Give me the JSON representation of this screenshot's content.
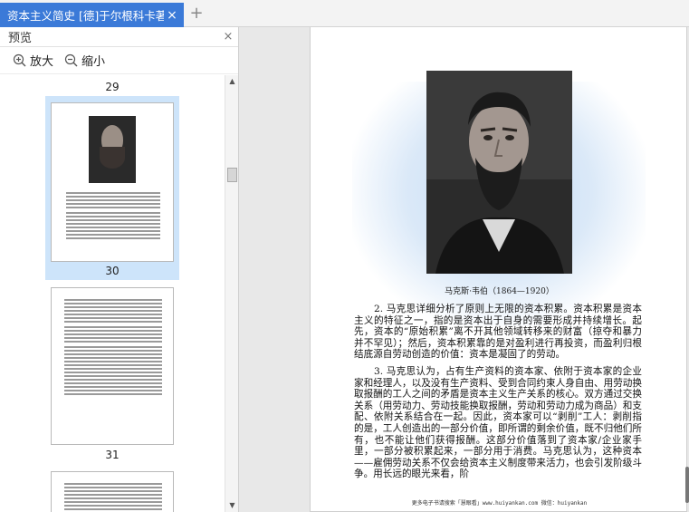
{
  "tab": {
    "title": "资本主义简史 [德]于尔根科卡著",
    "close": "×",
    "add": "+"
  },
  "preview": {
    "title": "预览",
    "close": "×",
    "zoom_in": "放大",
    "zoom_out": "缩小",
    "page_numbers": [
      "29",
      "30",
      "31"
    ]
  },
  "page": {
    "caption": "马克斯·韦伯（1864—1920）",
    "paragraph1": "2. 马克思详细分析了原则上无限的资本积累。资本积累是资本主义的特征之一，指的是资本出于自身的需要形成并持续增长。起先，资本的“原始积累”离不开其他领域转移来的财富（掠夺和暴力并不罕见）；然后，资本积累靠的是对盈利进行再投资，而盈利归根结底源自劳动创造的价值：资本是凝固了的劳动。",
    "paragraph2": "3. 马克思认为，占有生产资料的资本家、依附于资本家的企业家和经理人，以及没有生产资料、受到合同约束人身自由、用劳动换取报酬的工人之间的矛盾是资本主义生产关系的核心。双方通过交换关系（用劳动力、劳动技能换取报酬，劳动和劳动力成为商品）和支配、依附关系结合在一起。因此，资本家可以“剥削”工人：剥削指的是，工人创造出的一部分价值，即所谓的剩余价值，既不归他们所有，也不能让他们获得报酬。这部分价值落到了资本家/企业家手里，一部分被积累起来，一部分用于消费。马克思认为，这种资本——雇佣劳动关系不仅会给资本主义制度带来活力，也会引发阶级斗争。用长远的眼光来看，阶",
    "footer": "更多电子书请搜索「慧眼看」www.huiyankan.com  微信：huiyankan"
  },
  "colors": {
    "tab_active": "#3b7ad8",
    "selection": "#cde4fa",
    "glow": "#c4dcf5"
  },
  "icons": [
    "zoom-in-icon",
    "zoom-out-icon",
    "close-icon",
    "plus-icon",
    "scroll-up-icon",
    "scroll-down-icon"
  ]
}
